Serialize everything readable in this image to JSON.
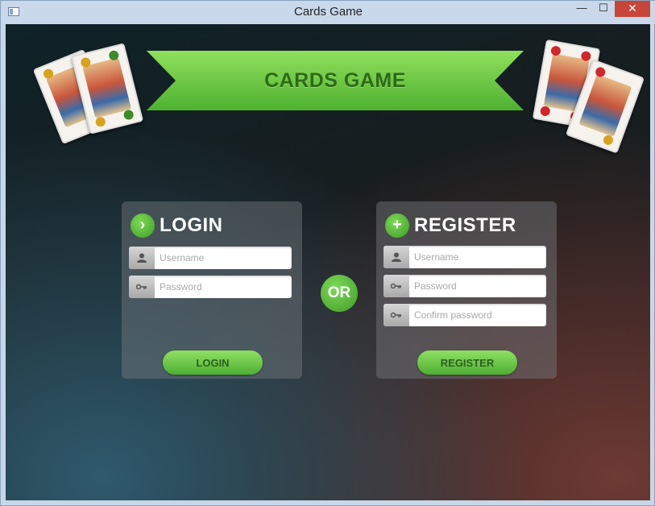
{
  "window": {
    "title": "Cards Game",
    "minimize_glyph": "—",
    "maximize_glyph": "☐",
    "close_glyph": "✕"
  },
  "banner": {
    "title": "CARDS GAME"
  },
  "login": {
    "icon": "›",
    "title": "LOGIN",
    "username_placeholder": "Username",
    "password_placeholder": "Password",
    "button_label": "LOGIN"
  },
  "or_label": "OR",
  "register": {
    "icon": "+",
    "title": "REGISTER",
    "username_placeholder": "Username",
    "password_placeholder": "Password",
    "confirm_placeholder": "Confirm password",
    "button_label": "REGISTER"
  },
  "icons": {
    "user": "user-icon",
    "key": "key-icon"
  },
  "colors": {
    "accent_green": "#5cbf3c",
    "banner_text": "#2d6a1a"
  }
}
